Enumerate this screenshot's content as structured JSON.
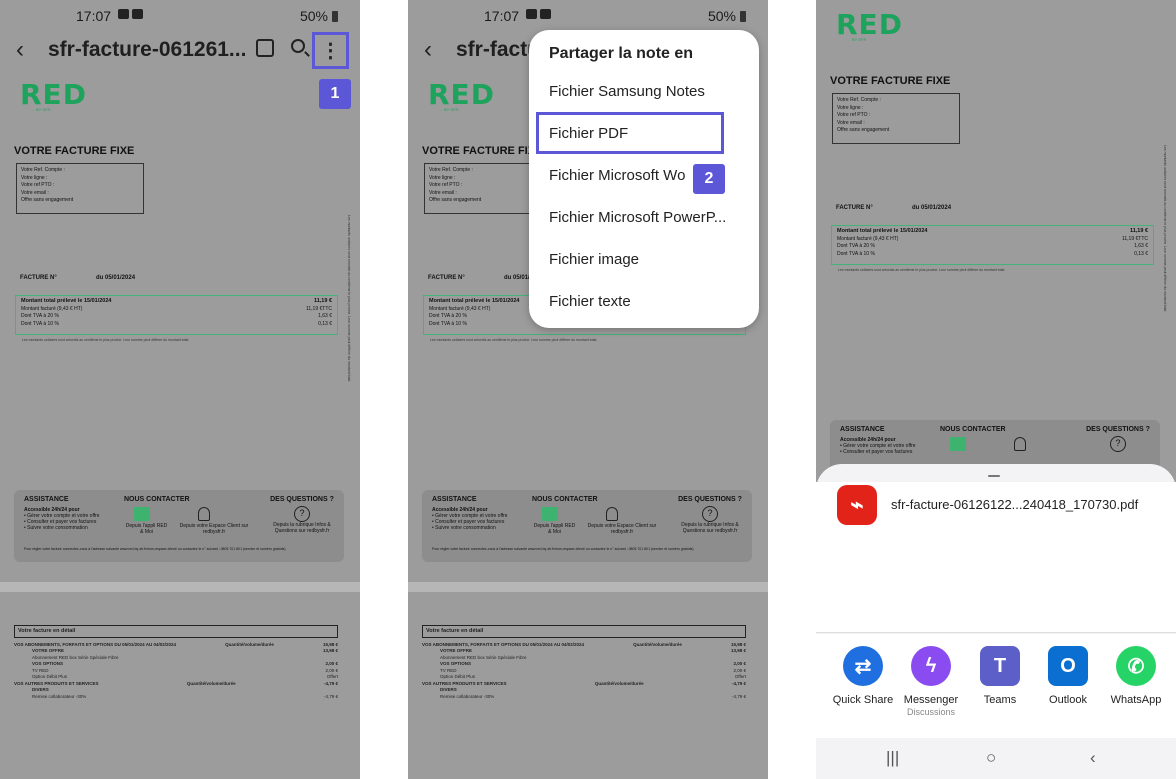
{
  "status": {
    "time": "17:07",
    "battery": "50%"
  },
  "appbar": {
    "title": "sfr-facture-061261...",
    "more_glyph": "⋮",
    "back_glyph": "‹"
  },
  "badges": {
    "step1": "1",
    "step2": "2"
  },
  "doc": {
    "logo": "RED",
    "logo_sub": "BY SFR",
    "title": "VOTRE FACTURE FIXE",
    "info_lines": [
      "Votre Ref. Compte :",
      "Votre ligne :",
      "Votre ref PTO :",
      "Votre email :",
      "Offre sans engagement"
    ],
    "facture_label": "FACTURE N°",
    "facture_date": "du 05/01/2024",
    "amount": {
      "label": "Montant total prélevé le 15/01/2024",
      "value": "11,19 €",
      "r1": "Montant facturé (9,43 € HT)",
      "r1v": "11,19 €TTC",
      "r2": "Dont TVA à 20 %",
      "r2v": "1,63 €",
      "r3": "Dont TVA à 10 %",
      "r3v": "0,13 €"
    },
    "note": "Les montants unitaires sont arrondis au centième le plus proche. Leur somme peut différer du montant total.",
    "assist": {
      "h1": "ASSISTANCE",
      "a1": "Accessible 24h/24 pour",
      "a2": "• Gérer votre compte et votre offre",
      "a3": "• Consulter et payer vos factures",
      "a4": "• Suivre votre consommation",
      "h2": "NOUS CONTACTER",
      "c1": "Depuis l'appli RED & Moi",
      "c2": "Depuis votre Espace Client sur redbysfr.fr",
      "h3": "DES QUESTIONS ?",
      "q1": "Depuis la rubrique Infos & Questions sur redbysfr.fr",
      "foot": "Pour régler votre facture connectez-vous à l'adresse suivante www.red-by-sfr.fr/mon-espace-client/ ou contactez le n° suivant : 0805 701 801 (service et numéro gratuits)"
    },
    "detail": {
      "header": "Votre facture en détail",
      "l1": "VOS ABONNEMENTS, FORFAITS ET OPTIONS DU 05/01/2024 AU 04/02/2024",
      "l1q": "Quantité/volume/durée",
      "l1v": "15,98 €",
      "l2": "VOTRE OFFRE",
      "l2v": "13,98 €",
      "l3": "Abonnement RED box Série Spéciale Fibre",
      "l4": "VOS OPTIONS",
      "l4v": "2,00 €",
      "l5": "TV RED",
      "l5v": "2,00 €",
      "l6": "Option Débit Plus",
      "l6v": "Offert",
      "l7": "VOS AUTRES PRODUITS ET SERVICES",
      "l7q": "Quantité/volume/durée",
      "l7v": "-4,79 €",
      "l8": "DIVERS",
      "l9": "Remise collaborateur -30%",
      "l9v": "-4,79 €"
    }
  },
  "menu": {
    "header": "Partager la note en",
    "items": [
      "Fichier Samsung Notes",
      "Fichier PDF",
      "Fichier Microsoft Wo",
      "Fichier Microsoft PowerP...",
      "Fichier image",
      "Fichier texte"
    ]
  },
  "share": {
    "filename": "sfr-facture-06126122...240418_170730.pdf",
    "apps": [
      {
        "label": "Quick Share",
        "sub": "",
        "color": "#1f6fe0",
        "icon": "quick-share-icon"
      },
      {
        "label": "Messenger",
        "sub": "Discussions",
        "color": "#8a4cf0",
        "icon": "messenger-icon"
      },
      {
        "label": "Teams",
        "sub": "",
        "color": "#5b5fc7",
        "icon": "teams-icon"
      },
      {
        "label": "Outlook",
        "sub": "",
        "color": "#0a6fd1",
        "icon": "outlook-icon"
      },
      {
        "label": "WhatsApp",
        "sub": "",
        "color": "#25d366",
        "icon": "whatsapp-icon"
      }
    ],
    "nav": {
      "recent": "|||",
      "home": "○",
      "back": "‹"
    }
  },
  "colors": {
    "accent": "#5b57d6",
    "red_green": "#1ea35c",
    "pdf_red": "#e2231a"
  }
}
